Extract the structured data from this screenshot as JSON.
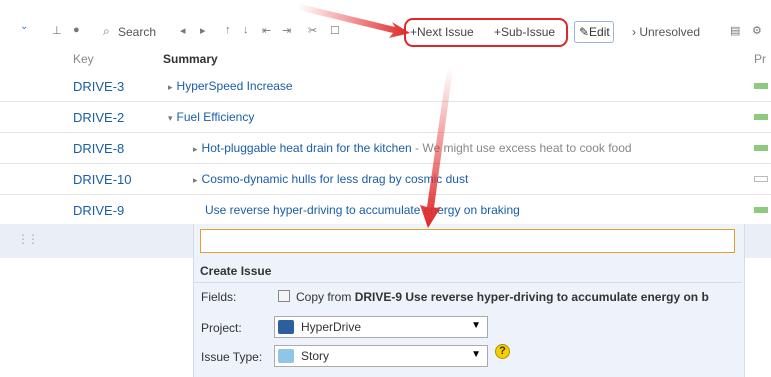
{
  "toolbar": {
    "search_label": "Search",
    "next_issue_label": "+Next Issue",
    "sub_issue_label": "+Sub-Issue",
    "edit_label": "✎Edit",
    "unresolved_label": "› Unresolved"
  },
  "columns": {
    "key": "Key",
    "summary": "Summary",
    "priority": "Pr"
  },
  "rows": [
    {
      "key": "DRIVE-3",
      "summary": "HyperSpeed Increase",
      "toggle": "▸"
    },
    {
      "key": "DRIVE-2",
      "summary": "Fuel Efficiency",
      "toggle": "▾"
    },
    {
      "key": "DRIVE-8",
      "summary": "Hot-pluggable heat drain for the kitchen",
      "desc": " - We might use excess heat to cook food",
      "toggle": "▸"
    },
    {
      "key": "DRIVE-10",
      "summary": "Cosmo-dynamic hulls for less drag by cosmic dust",
      "toggle": "▸"
    },
    {
      "key": "DRIVE-9",
      "summary": "Use reverse hyper-driving to accumulate energy on braking"
    }
  ],
  "create_issue": {
    "title": "Create Issue",
    "fields_label": "Fields:",
    "copy_prefix": "Copy from ",
    "copy_bold": "DRIVE-9 Use reverse hyper-driving to accumulate energy on b",
    "project_label": "Project:",
    "project_value": "HyperDrive",
    "issue_type_label": "Issue Type:",
    "issue_type_value": "Story",
    "help_glyph": "?"
  },
  "colors": {
    "highlight": "#e02626",
    "link": "#1a5da8",
    "priority": "#8ec97d"
  }
}
